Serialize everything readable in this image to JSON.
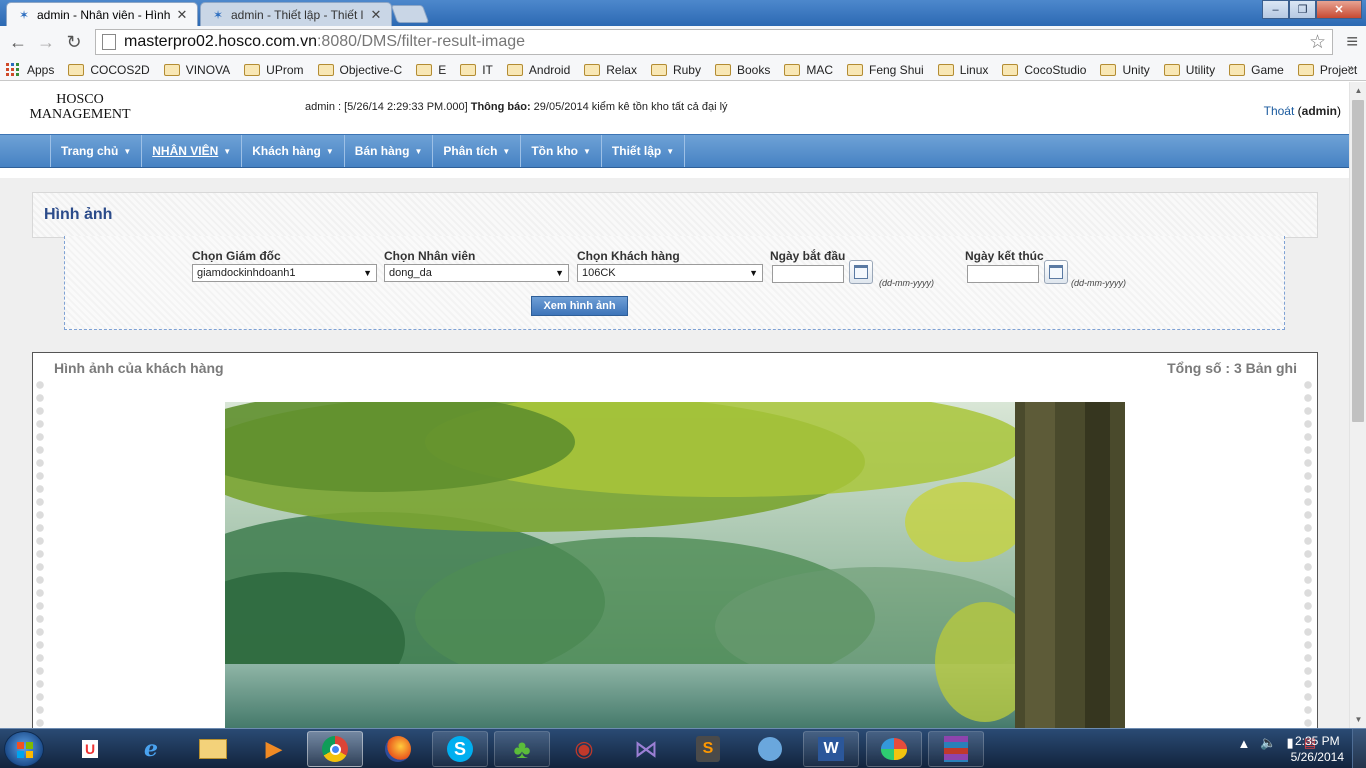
{
  "browser": {
    "tabs": [
      {
        "title": "admin - Nhân viên - Hình",
        "active": true
      },
      {
        "title": "admin - Thiết lập - Thiết l",
        "active": false
      }
    ],
    "url_host": "masterpro02.hosco.com.vn",
    "url_rest": ":8080/DMS/filter-result-image",
    "bookmarks": {
      "apps_label": "Apps",
      "folders": [
        "COCOS2D",
        "VINOVA",
        "UProm",
        "Objective-C",
        "E",
        "IT",
        "Android",
        "Relax",
        "Ruby",
        "Books",
        "MAC",
        "Feng Shui",
        "Linux",
        "CocoStudio",
        "Unity",
        "Utility",
        "Game",
        "Project"
      ]
    }
  },
  "header": {
    "logo_line1": "HOSCO",
    "logo_line2": "MANAGEMENT",
    "status_user": "admin : [5/26/14 2:29:33 PM.000]",
    "notice_label": "Thông báo:",
    "notice_text": " 29/05/2014 kiểm kê tồn kho tất cả đại lý",
    "logout_label": "Thoát",
    "logout_user": "admin"
  },
  "nav": [
    {
      "label": "Trang chủ"
    },
    {
      "label": "NHÂN VIÊN",
      "current": true
    },
    {
      "label": "Khách hàng"
    },
    {
      "label": "Bán hàng"
    },
    {
      "label": "Phân tích"
    },
    {
      "label": "Tồn kho"
    },
    {
      "label": "Thiết lập"
    }
  ],
  "panel": {
    "title": "Hình ảnh"
  },
  "filters": {
    "director_label": "Chọn Giám đốc",
    "director_value": "giamdockinhdoanh1",
    "employee_label": "Chọn Nhân viên",
    "employee_value": "dong_da",
    "customer_label": "Chọn Khách hàng",
    "customer_value": "106CK",
    "start_label": "Ngày bắt đầu",
    "end_label": "Ngày kết thúc",
    "date_hint": "(dd-mm-yyyy)",
    "view_button": "Xem hình ảnh"
  },
  "gallery": {
    "title": "Hình ảnh của khách hàng",
    "count": "Tổng số : 3 Bản ghi"
  },
  "taskbar": {
    "time": "2:35 PM",
    "date": "5/26/2014",
    "apps": [
      "unikey-icon",
      "internet-explorer-icon",
      "explorer-icon",
      "media-player-icon",
      "chrome-icon",
      "firefox-icon",
      "skype-icon",
      "clover-icon",
      "bag-icon",
      "visual-studio-icon",
      "sublime-icon",
      "mascot-icon",
      "word-icon",
      "paint-icon",
      "winrar-icon"
    ]
  },
  "colors": {
    "nav_bg": "#4682c3",
    "title_blue": "#2b4b8a",
    "link_blue": "#1a5a9e"
  }
}
